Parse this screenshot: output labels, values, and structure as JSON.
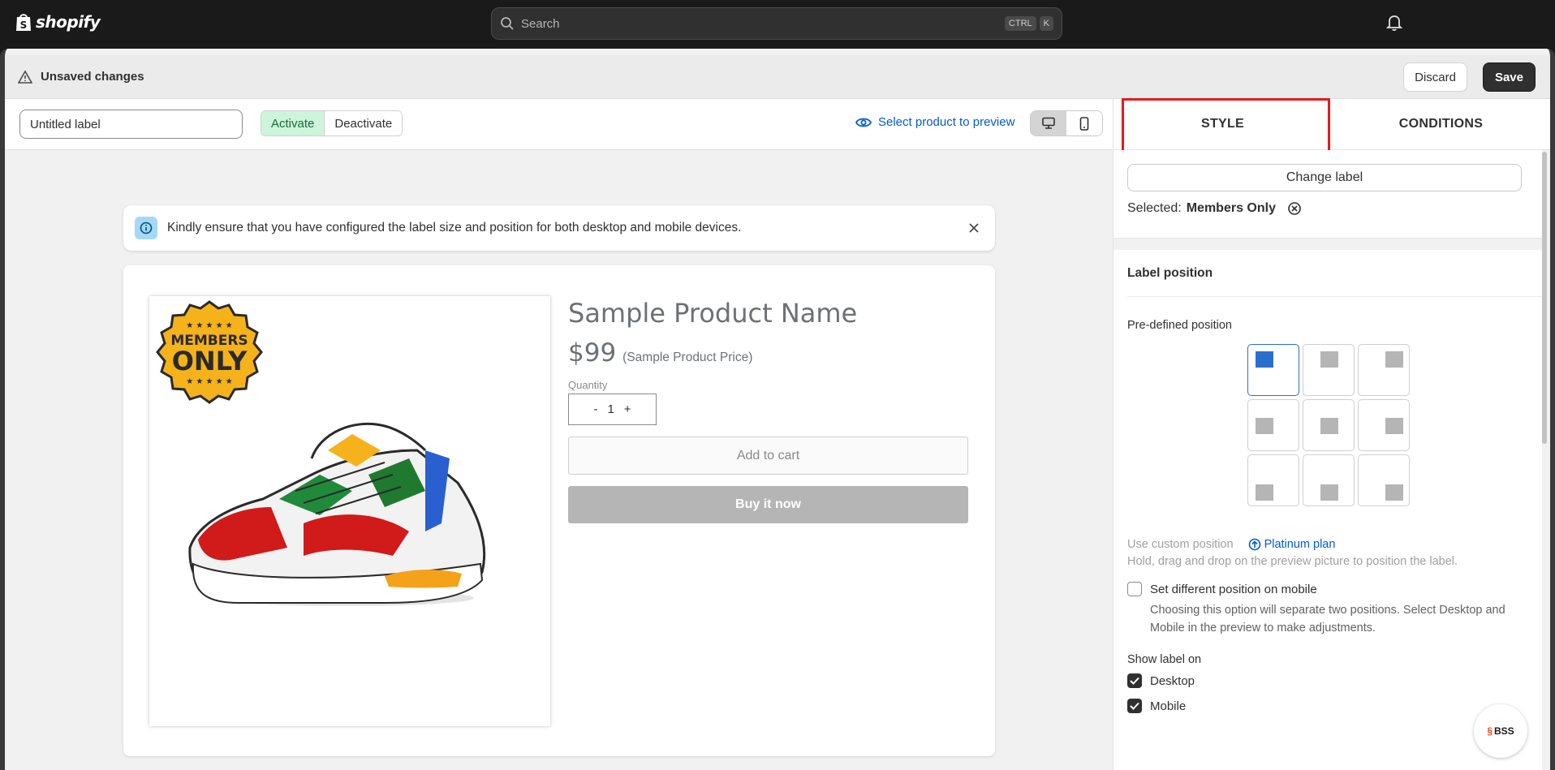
{
  "brand": {
    "name": "shopify"
  },
  "search": {
    "placeholder": "Search",
    "shortcut_ctrl": "CTRL",
    "shortcut_key": "K"
  },
  "savebar": {
    "title": "Unsaved changes",
    "discard": "Discard",
    "save": "Save"
  },
  "toolbar": {
    "label_value": "Untitled label",
    "activate": "Activate",
    "deactivate": "Deactivate",
    "preview_link": "Select product to preview",
    "device_selected": "desktop"
  },
  "banner": {
    "text": "Kindly ensure that you have configured the label size and position for both desktop and mobile devices."
  },
  "product": {
    "name": "Sample Product Name",
    "price": "$99",
    "price_note": "(Sample Product Price)",
    "qty_label": "Quantity",
    "qty_minus": "-",
    "qty_value": "1",
    "qty_plus": "+",
    "add_to_cart": "Add to cart",
    "buy_now": "Buy it now",
    "badge_line1": "MEMBERS",
    "badge_line2": "ONLY"
  },
  "panel": {
    "tabs": [
      "STYLE",
      "CONDITIONS"
    ],
    "active_tab": "STYLE",
    "change_label": "Change label",
    "selected_prefix": "Selected:",
    "selected_value": "Members Only",
    "position_title": "Label position",
    "predefined_label": "Pre-defined position",
    "predefined_selected": "top-left",
    "custom_label": "Use custom position",
    "plan_link": "Platinum plan",
    "custom_help": "Hold, drag and drop on the preview picture to position the label.",
    "mobile_diff_label": "Set different position on mobile",
    "mobile_diff_checked": false,
    "mobile_note": "Choosing this option will separate two positions. Select Desktop and Mobile in the preview to make adjustments.",
    "show_on_label": "Show label on",
    "show_desktop": "Desktop",
    "show_desktop_checked": true,
    "show_mobile": "Mobile",
    "show_mobile_checked": true
  },
  "widget": {
    "text": "BSS"
  },
  "colors": {
    "accent": "#005bd3",
    "highlight": "#e8191b",
    "activate_bg": "#cdf5dc",
    "badge": "#f5b21b"
  }
}
